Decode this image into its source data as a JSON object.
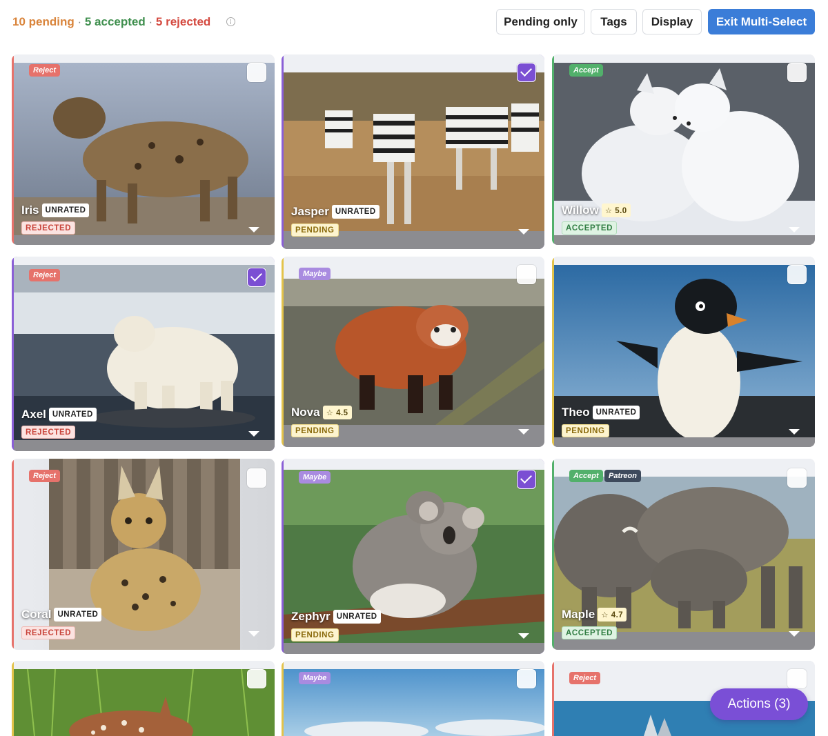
{
  "summary": {
    "pending": "10 pending",
    "accepted": "5 accepted",
    "rejected": "5 rejected",
    "separator": "·"
  },
  "toolbar": {
    "pending_only": "Pending only",
    "tags": "Tags",
    "display": "Display",
    "exit_multi_select": "Exit Multi-Select"
  },
  "colors": {
    "accent": "#7a4fd6",
    "primary_button": "#3b7dd8",
    "reject": "#e6726b",
    "accept": "#52b06b",
    "maybe": "#a98be0",
    "pending": "#d9843b"
  },
  "cards": [
    {
      "name": "Iris",
      "rating": "UNRATED",
      "status": "REJECTED",
      "tags": [
        "Reject"
      ],
      "checked": false,
      "image": "hyena"
    },
    {
      "name": "Jasper",
      "rating": "UNRATED",
      "status": "PENDING",
      "tags": [],
      "checked": true,
      "image": "zebras"
    },
    {
      "name": "Willow",
      "rating": "☆ 5.0",
      "status": "ACCEPTED",
      "tags": [
        "Accept"
      ],
      "checked": false,
      "image": "arctic foxes"
    },
    {
      "name": "Axel",
      "rating": "UNRATED",
      "status": "REJECTED",
      "tags": [
        "Reject"
      ],
      "checked": true,
      "image": "polar bear"
    },
    {
      "name": "Nova",
      "rating": "☆ 4.5",
      "status": "PENDING",
      "tags": [
        "Maybe"
      ],
      "checked": false,
      "image": "red panda"
    },
    {
      "name": "Theo",
      "rating": "UNRATED",
      "status": "PENDING",
      "tags": [],
      "checked": false,
      "image": "penguin"
    },
    {
      "name": "Coral",
      "rating": "UNRATED",
      "status": "REJECTED",
      "tags": [
        "Reject"
      ],
      "checked": false,
      "image": "serval"
    },
    {
      "name": "Zephyr",
      "rating": "UNRATED",
      "status": "PENDING",
      "tags": [
        "Maybe"
      ],
      "checked": true,
      "image": "koalas"
    },
    {
      "name": "Maple",
      "rating": "☆ 4.7",
      "status": "ACCEPTED",
      "tags": [
        "Accept",
        "Patreon"
      ],
      "checked": false,
      "image": "elephants"
    },
    {
      "name": "",
      "rating": "",
      "status": "",
      "tags": [],
      "checked": false,
      "image": "fawn"
    },
    {
      "name": "",
      "rating": "",
      "status": "",
      "tags": [
        "Maybe"
      ],
      "checked": false,
      "image": "sky"
    },
    {
      "name": "",
      "rating": "",
      "status": "",
      "tags": [
        "Reject"
      ],
      "checked": false,
      "image": "water"
    }
  ],
  "actions_button": "Actions (3)"
}
